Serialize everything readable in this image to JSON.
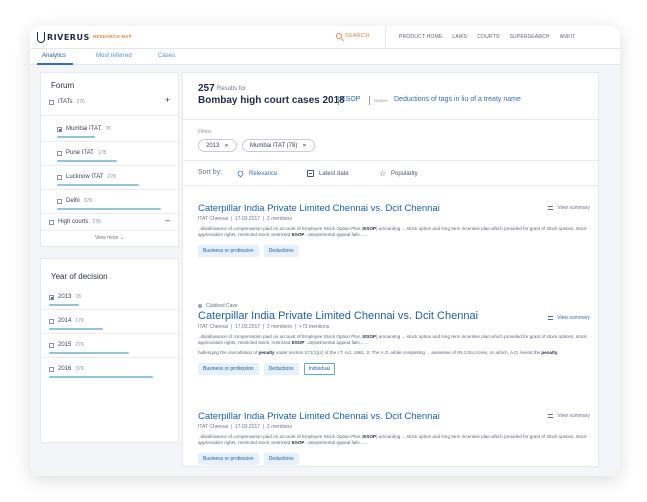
{
  "header": {
    "logo_text": "RIVERUS",
    "research_map": "RESEARCH MAP",
    "search_label": "SEARCH",
    "nav": [
      "PRODUCT HOME",
      "LAWS",
      "COURTS",
      "SUPERSEARCH",
      "ANKIT"
    ]
  },
  "tabs": [
    "Analytics",
    "Most referred",
    "Cases"
  ],
  "forum": {
    "title": "Forum",
    "itats": {
      "label": "ITATs",
      "count": "376",
      "toggle": "+"
    },
    "items": [
      {
        "label": "Mumbai ITAT",
        "count": "78"
      },
      {
        "label": "Pune ITAT",
        "count": "178"
      },
      {
        "label": "Lucknow ITAT",
        "count": "278"
      },
      {
        "label": "Delhi",
        "count": "378"
      }
    ],
    "high_courts": {
      "label": "High courts",
      "count": "378",
      "toggle": "–"
    },
    "view_more": "View more"
  },
  "year": {
    "title": "Year of decision",
    "items": [
      {
        "label": "2013",
        "count": "78"
      },
      {
        "label": "2014",
        "count": "178"
      },
      {
        "label": "2015",
        "count": "278"
      },
      {
        "label": "2016",
        "count": "378"
      }
    ]
  },
  "results_header": {
    "count": "257",
    "results_for": "Results for",
    "query": "Bombay high court cases 2018",
    "tag": "ESOP",
    "issues_label": "Issues:",
    "issues_value": "Deductions of tags in liu of a treaty name"
  },
  "filters": {
    "label": "Filters",
    "chips": [
      "2013",
      "Mumbai ITAT (78)"
    ]
  },
  "sort": {
    "label": "Sort by:",
    "options": [
      "Relevance",
      "Latest date",
      "Popularity"
    ]
  },
  "results": [
    {
      "title": "Caterpillar India Private Limited Chennai vs. Dcit Chennai",
      "meta": [
        "ITAT Chennai",
        "17.03.2017",
        "2 members"
      ],
      "snippet_1": "..disallowance of compensation paid on account of Employee Stock Option Plan (ESOP) amounting ... stock option and long term incentive plan which provided for grant of stock options, stock appreciation rights, restricted stock, restricted ESOP ..departmental appeal fails.......",
      "tags": [
        "Business or profession",
        "Deductions"
      ],
      "view_summary": "View summary"
    },
    {
      "clubbed": "Clubbed Case",
      "title": "Caterpillar India Private Limited Chennai vs. Dcit Chennai",
      "meta": [
        "ITAT Chennai",
        "17.03.2017",
        "2 members",
        "+73 mentions"
      ],
      "snippet_1": "..disallowance of compensation paid on account of Employee Stock Option Plan (ESOP) amounting ... stock option and long term incentive plan which provided for grant of stock options, stock appreciation rights, restricted stock, restricted ESOP ..departmental appeal fails.......",
      "snippet_2": "hallenging the cancellation of penalty under section 271(1)(c) of the I.T. Act, 1961. 2. The A.O. while completing ... assessee of Rs.3.04 crores, on which, A.O. levied the penalty.",
      "tags": [
        "Business or profession",
        "Deductions",
        "Individual"
      ],
      "view_summary": "View summary"
    },
    {
      "title": "Caterpillar India Private Limited Chennai vs. Dcit Chennai",
      "meta": [
        "ITAT Chennai",
        "17.03.2017",
        "2 members"
      ],
      "snippet_1": "..disallowance of compensation paid on account of Employee Stock Option Plan (ESOP) amounting ... stock option and long term incentive plan which provided for grant of stock options, stock appreciation rights, restricted stock, restricted ESOP ..departmental appeal fails.......",
      "tags": [
        "Business or profession",
        "Deductions"
      ],
      "view_summary": "View summary"
    }
  ],
  "colors": {
    "accent": "#2f6fbd",
    "brand_orange": "#e8823c",
    "highlight": "#8fc6da"
  }
}
